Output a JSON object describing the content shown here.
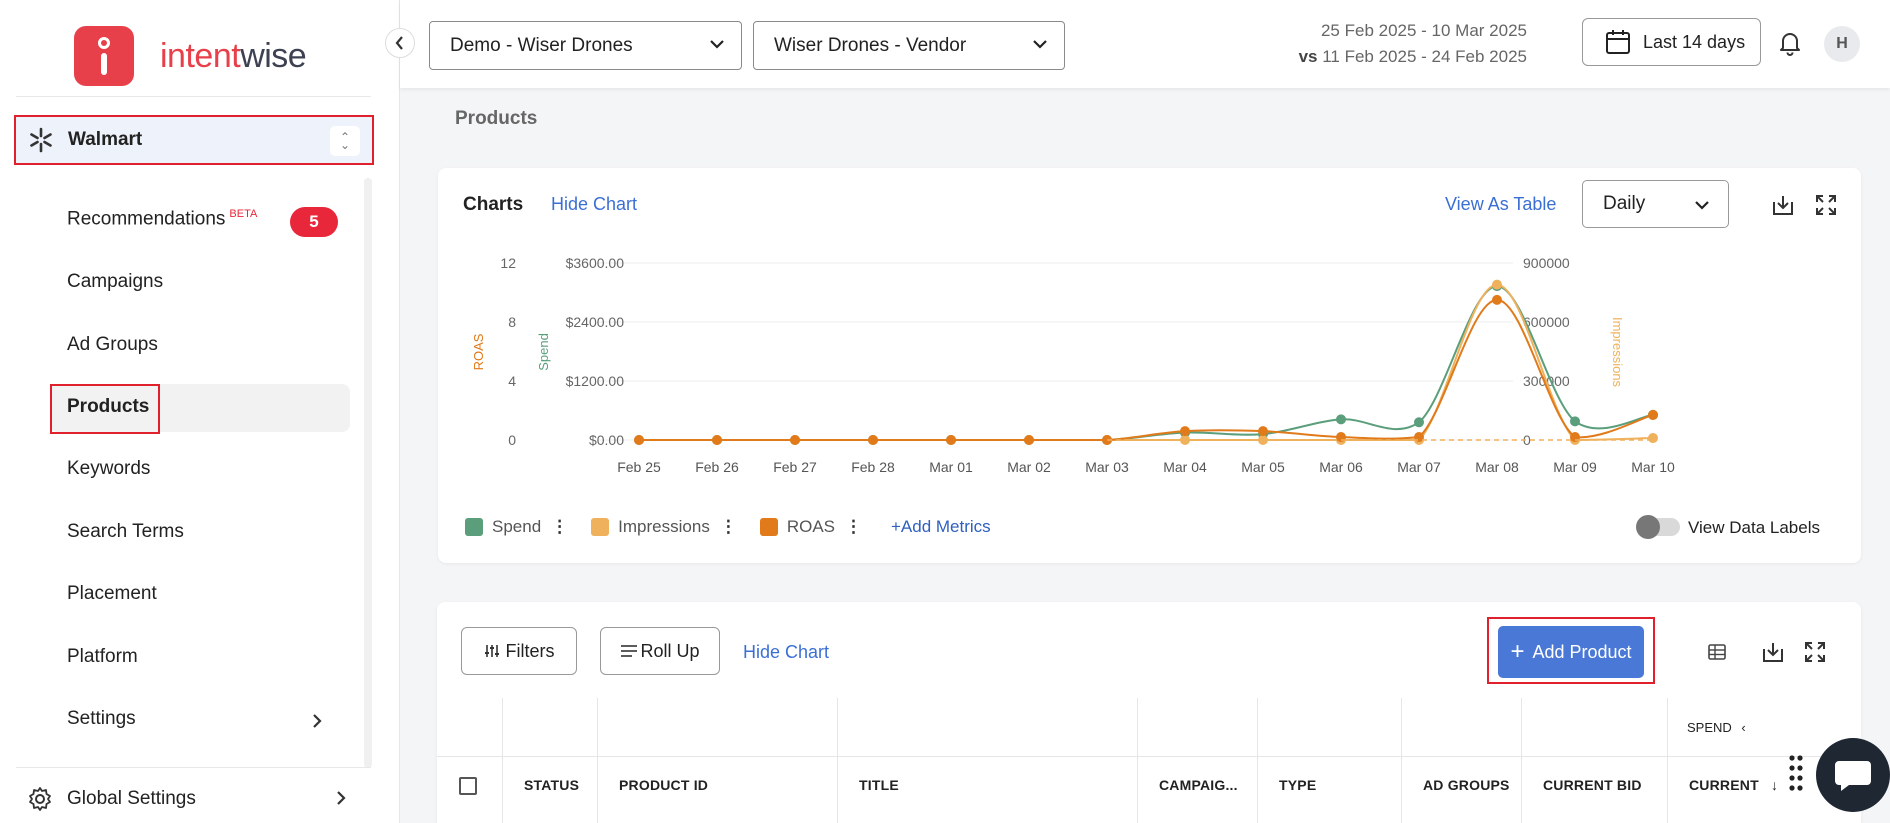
{
  "brand": {
    "part1": "intent",
    "part2": "wise"
  },
  "retailer": {
    "name": "Walmart"
  },
  "nav": {
    "recommendations": "Recommendations",
    "beta": "BETA",
    "rec_count": "5",
    "campaigns": "Campaigns",
    "ad_groups": "Ad Groups",
    "products": "Products",
    "keywords": "Keywords",
    "search_terms": "Search Terms",
    "placement": "Placement",
    "platform": "Platform",
    "settings": "Settings",
    "global_settings": "Global Settings"
  },
  "header": {
    "account": "Demo - Wiser Drones",
    "profile": "Wiser Drones - Vendor",
    "date_range": "25 Feb 2025 - 10 Mar 2025",
    "vs_label": "vs",
    "compare_range": "11 Feb 2025 - 24 Feb 2025",
    "range_button": "Last 14 days",
    "avatar_initial": "H"
  },
  "page": {
    "title": "Products"
  },
  "chart_card": {
    "title": "Charts",
    "hide_chart": "Hide Chart",
    "view_as_table": "View As Table",
    "granularity": "Daily",
    "add_metrics": "+Add Metrics",
    "view_data_labels": "View Data Labels"
  },
  "chart_data": {
    "type": "line",
    "x": [
      "Feb 25",
      "Feb 26",
      "Feb 27",
      "Feb 28",
      "Mar 01",
      "Mar 02",
      "Mar 03",
      "Mar 04",
      "Mar 05",
      "Mar 06",
      "Mar 07",
      "Mar 08",
      "Mar 09",
      "Mar 10"
    ],
    "series": [
      {
        "name": "Spend",
        "color": "#5a9e7c",
        "axis": "spend",
        "values": [
          0,
          0,
          0,
          0,
          0,
          0,
          0,
          150,
          120,
          420,
          360,
          3130,
          380,
          510
        ]
      },
      {
        "name": "Impressions",
        "color": "#f0b15c",
        "axis": "impressions",
        "values": [
          0,
          0,
          0,
          0,
          0,
          0,
          0,
          0,
          0,
          0,
          0,
          790000,
          0,
          10000
        ]
      },
      {
        "name": "ROAS",
        "color": "#e07a1a",
        "axis": "roas",
        "values": [
          0,
          0,
          0,
          0,
          0,
          0,
          0,
          0.6,
          0.6,
          0.2,
          0.2,
          9.5,
          0.2,
          1.7
        ]
      }
    ],
    "axes": {
      "roas": {
        "label": "ROAS",
        "ticks": [
          "0",
          "4",
          "8",
          "12"
        ],
        "range": [
          0,
          12
        ]
      },
      "spend": {
        "label": "Spend",
        "ticks": [
          "$0.00",
          "$1200.00",
          "$2400.00",
          "$3600.00"
        ],
        "range": [
          0,
          3600
        ]
      },
      "impressions": {
        "label": "Impressions",
        "ticks": [
          "0",
          "300000",
          "600000",
          "900000"
        ],
        "range": [
          0,
          900000
        ]
      }
    },
    "grid": true,
    "legend_position": "bottom-left"
  },
  "table_card": {
    "filters": "Filters",
    "roll_up": "Roll Up",
    "hide_chart": "Hide Chart",
    "add_product": "Add Product",
    "spend_group": "SPEND",
    "columns": [
      "STATUS",
      "PRODUCT ID",
      "TITLE",
      "CAMPAIG...",
      "TYPE",
      "AD GROUPS",
      "CURRENT BID",
      "CURRENT"
    ]
  }
}
